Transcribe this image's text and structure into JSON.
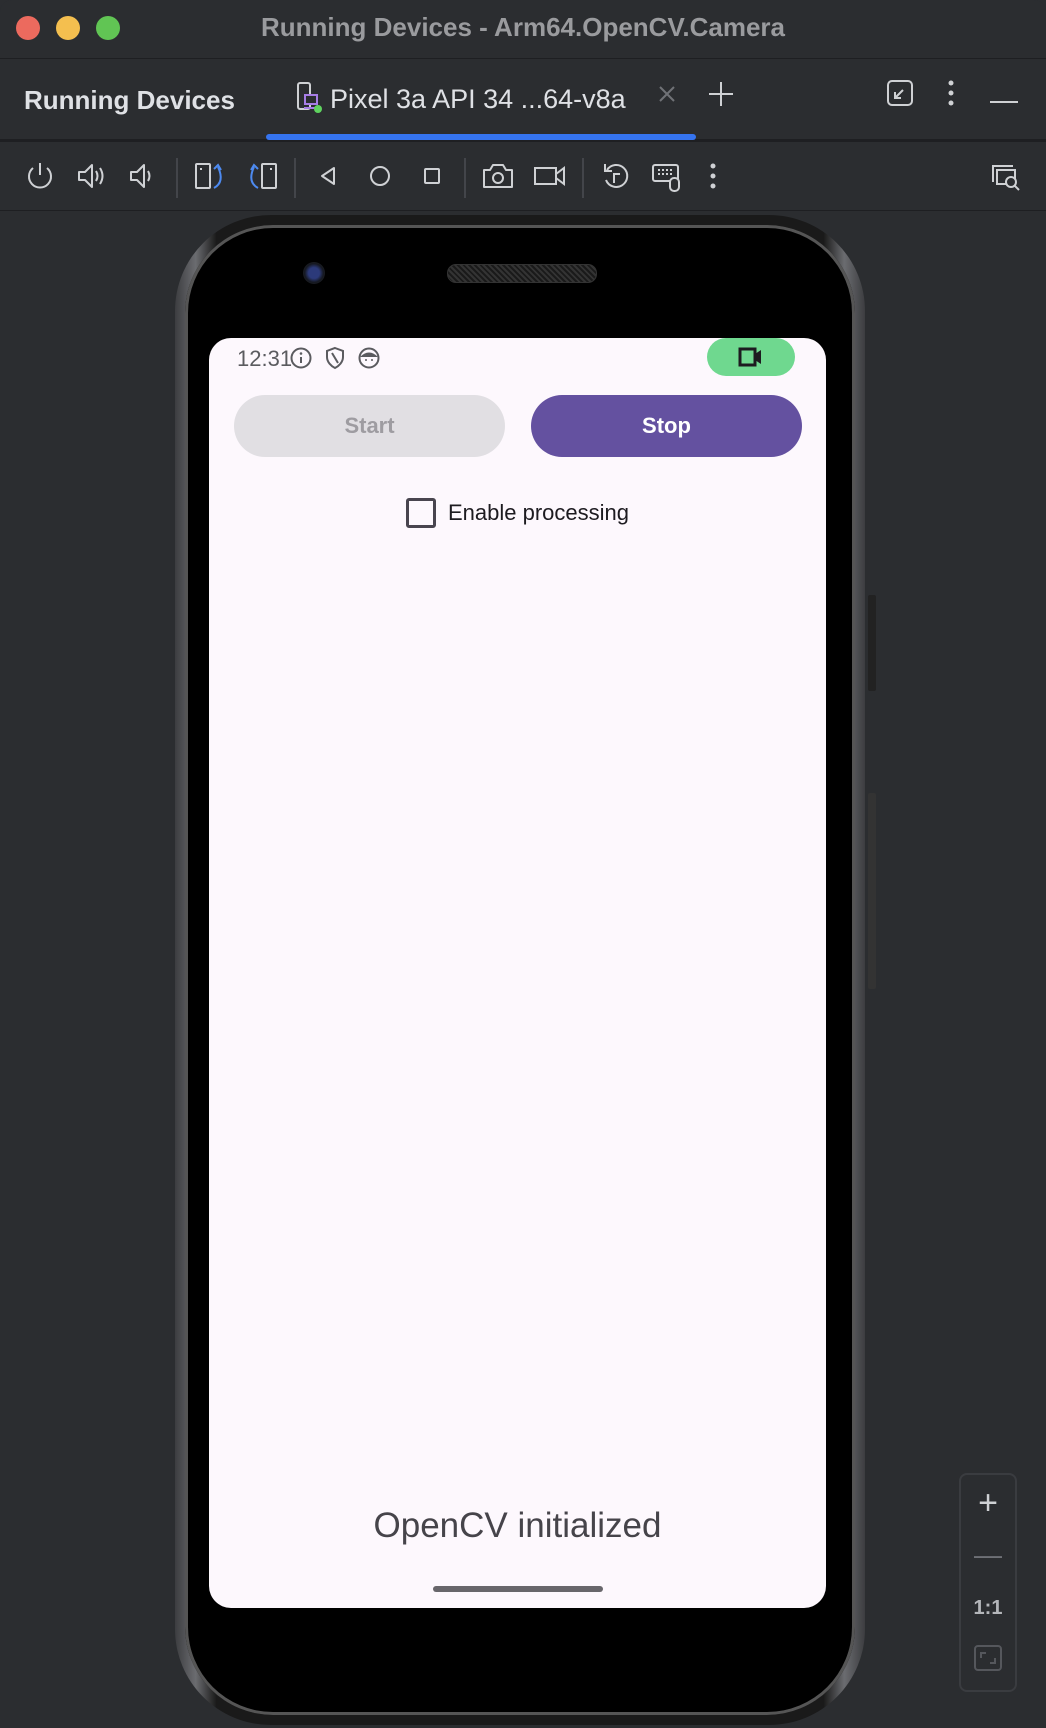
{
  "window": {
    "title": "Running Devices - Arm64.OpenCV.Camera",
    "traffic_lights": {
      "close": "#ec6a5e",
      "minimize": "#f4bf4f",
      "maximize": "#61c554"
    }
  },
  "tabbar": {
    "panel_title": "Running Devices",
    "tabs": [
      {
        "label": "Pixel 3a API 34 ...64-v8a",
        "icon": "device-icon",
        "active": true,
        "status_dot_color": "#5fd35f"
      }
    ],
    "add_tab_icon": "plus-icon",
    "actions": [
      {
        "icon": "restore-down-icon"
      },
      {
        "icon": "more-vertical-icon"
      },
      {
        "icon": "minimize-icon"
      }
    ],
    "accent_color": "#3574f0"
  },
  "toolbar": {
    "buttons": [
      {
        "icon": "power-icon"
      },
      {
        "icon": "volume-up-icon"
      },
      {
        "icon": "volume-down-icon"
      },
      {
        "icon": "rotate-left-icon"
      },
      {
        "icon": "rotate-right-icon"
      },
      {
        "icon": "back-icon"
      },
      {
        "icon": "home-icon"
      },
      {
        "icon": "overview-icon"
      },
      {
        "icon": "screenshot-icon"
      },
      {
        "icon": "screen-record-icon"
      },
      {
        "icon": "reset-rotation-icon"
      },
      {
        "icon": "keyboard-mouse-icon"
      },
      {
        "icon": "more-vertical-icon"
      }
    ],
    "right_icon": "window-search-icon"
  },
  "device": {
    "status_bar": {
      "time": "12:31",
      "icons": [
        "info-icon",
        "shield-icon",
        "android-face-icon"
      ],
      "recording_pill_color": "#6fd88f",
      "recording_icon": "video-camera-icon"
    },
    "app": {
      "start_label": "Start",
      "start_enabled": false,
      "stop_label": "Stop",
      "stop_color": "#6451a0",
      "checkbox_label": "Enable processing",
      "checkbox_checked": false,
      "status_message": "OpenCV initialized"
    }
  },
  "zoom_controls": {
    "zoom_in": "+",
    "zoom_out": "—",
    "actual_size": "1:1",
    "fit_icon": "fit-screen-icon"
  }
}
